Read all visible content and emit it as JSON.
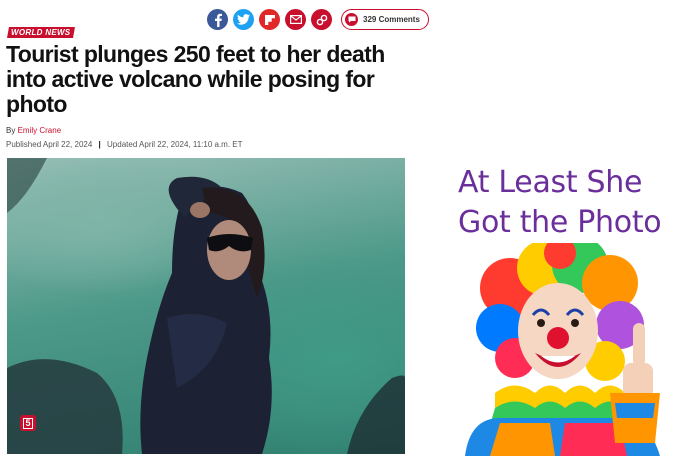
{
  "article": {
    "category": "WORLD NEWS",
    "headline": "Tourist plunges 250 feet to her death into active volcano while posing for photo",
    "byline_prefix": "By",
    "author": "Emily Crane",
    "published": "Published April 22, 2024",
    "separator": "|",
    "updated": "Updated April 22, 2024, 11:10 a.m. ET",
    "video_badge_icon": "video-number-icon",
    "video_badge_label": "5"
  },
  "share": {
    "icons": [
      "facebook-icon",
      "twitter-icon",
      "flipboard-icon",
      "email-icon",
      "link-icon"
    ],
    "comments_label": "329 Comments"
  },
  "meme": {
    "caption_line1": "At Least She",
    "caption_line2": "Got the Photo"
  },
  "colors": {
    "brand_red": "#c8102e",
    "facebook": "#3b5998",
    "twitter": "#1da1f2",
    "caption_purple": "#6b2f9c"
  }
}
